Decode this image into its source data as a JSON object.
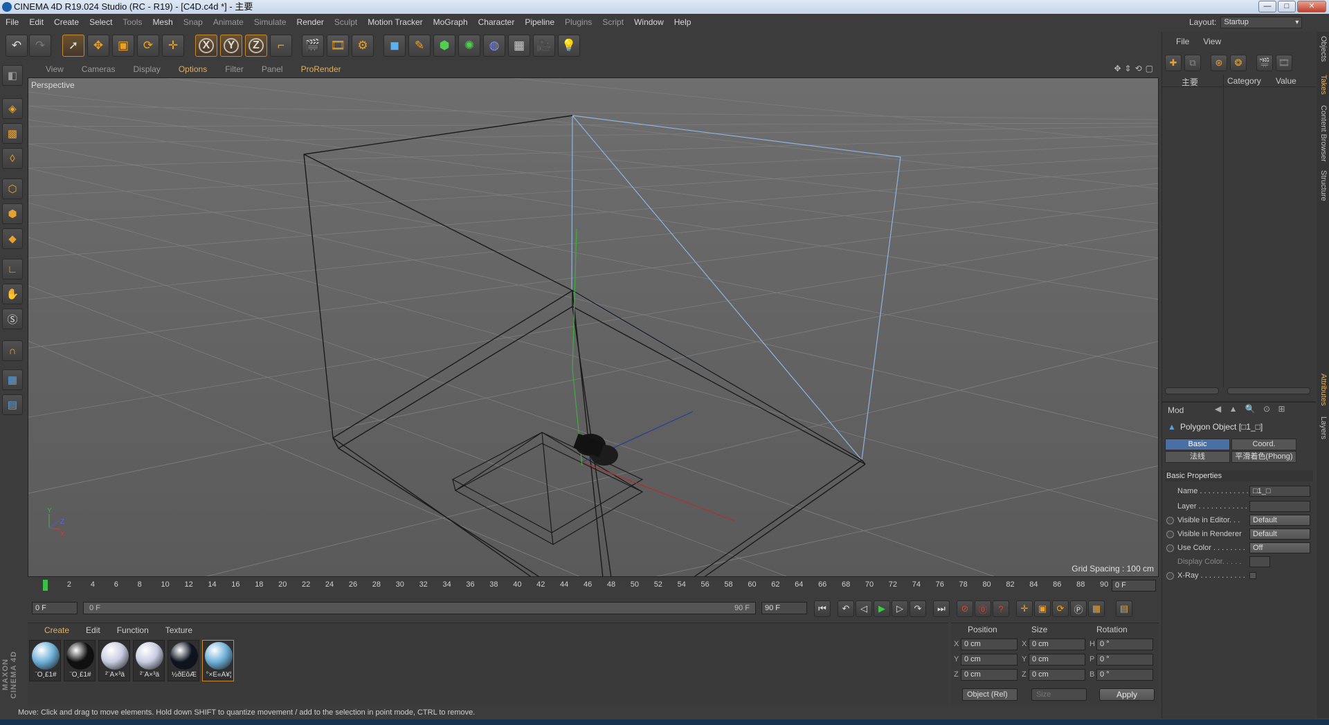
{
  "window": {
    "title": "CINEMA 4D R19.024 Studio (RC - R19) - [C4D.c4d *] - 主要",
    "minimize": "—",
    "maximize": "□",
    "close": "✕"
  },
  "menubar": {
    "items": [
      {
        "label": "File"
      },
      {
        "label": "Edit"
      },
      {
        "label": "Create"
      },
      {
        "label": "Select"
      },
      {
        "label": "Tools"
      },
      {
        "label": "Mesh"
      },
      {
        "label": "Snap"
      },
      {
        "label": "Animate"
      },
      {
        "label": "Simulate"
      },
      {
        "label": "Render"
      },
      {
        "label": "Sculpt"
      },
      {
        "label": "Motion Tracker"
      },
      {
        "label": "MoGraph"
      },
      {
        "label": "Character"
      },
      {
        "label": "Pipeline"
      },
      {
        "label": "Plugins"
      },
      {
        "label": "Script"
      },
      {
        "label": "Window"
      },
      {
        "label": "Help"
      }
    ],
    "layout_label": "Layout:",
    "layout_value": "Startup"
  },
  "toolbar": {
    "axis_x": "X",
    "axis_y": "Y",
    "axis_z": "Z"
  },
  "viewport": {
    "menu": [
      {
        "label": "View"
      },
      {
        "label": "Cameras"
      },
      {
        "label": "Display"
      },
      {
        "label": "Options"
      },
      {
        "label": "Filter"
      },
      {
        "label": "Panel"
      },
      {
        "label": "ProRender"
      }
    ],
    "camera_label": "Perspective",
    "grid_spacing": "Grid Spacing : 100 cm",
    "axis_y": "Y",
    "axis_z": "Z",
    "axis_x": "X"
  },
  "timeline": {
    "ticks": [
      "0",
      "2",
      "4",
      "6",
      "8",
      "10",
      "12",
      "14",
      "16",
      "18",
      "20",
      "22",
      "24",
      "26",
      "28",
      "30",
      "32",
      "34",
      "36",
      "38",
      "40",
      "42",
      "44",
      "46",
      "48",
      "50",
      "52",
      "54",
      "56",
      "58",
      "60",
      "62",
      "64",
      "66",
      "68",
      "70",
      "72",
      "74",
      "76",
      "78",
      "80",
      "82",
      "84",
      "86",
      "88",
      "90"
    ],
    "current_frame_field": "0 F",
    "start_field": "0 F",
    "slider_start": "0 F",
    "slider_end": "90 F",
    "end_field": "90 F"
  },
  "materials": {
    "menu": [
      {
        "label": "Create"
      },
      {
        "label": "Edit"
      },
      {
        "label": "Function"
      },
      {
        "label": "Texture"
      }
    ],
    "items": [
      {
        "name": "¨O¸£1#",
        "color": "#6fb0d8"
      },
      {
        "name": "¨O¸£1#",
        "color": "#101010"
      },
      {
        "name": "²¨Â×³ä",
        "color": "#c8cce0"
      },
      {
        "name": "²¨Â×³ä",
        "color": "#c8cce0"
      },
      {
        "name": "½ðÊôÆ",
        "color": "#0e1420"
      },
      {
        "name": "°×É«Â¥¦",
        "color": "#6fb0d8"
      }
    ]
  },
  "coords": {
    "head_position": "Position",
    "head_size": "Size",
    "head_rotation": "Rotation",
    "rows": [
      {
        "a1": "X",
        "v1": "0 cm",
        "a2": "X",
        "v2": "0 cm",
        "a3": "H",
        "v3": "0 °"
      },
      {
        "a1": "Y",
        "v1": "0 cm",
        "a2": "Y",
        "v2": "0 cm",
        "a3": "P",
        "v3": "0 °"
      },
      {
        "a1": "Z",
        "v1": "0 cm",
        "a2": "Z",
        "v2": "0 cm",
        "a3": "B",
        "v3": "0 °"
      }
    ],
    "mode": "Object (Rel)",
    "size_mode": "Size",
    "apply": "Apply"
  },
  "status": "Move: Click and drag to move elements. Hold down SHIFT to quantize movement / add to the selection in point mode, CTRL to remove.",
  "objects": {
    "menu": [
      {
        "label": "File"
      },
      {
        "label": "View"
      }
    ],
    "col_name": "主要",
    "col_category": "Category",
    "col_value": "Value"
  },
  "attributes": {
    "menu": "Mod",
    "title": "Polygon Object [□1_□]",
    "tabs": {
      "basic": "Basic",
      "coord": "Coord.",
      "normal": "法线",
      "phong": "平滑着色(Phong)"
    },
    "section": "Basic Properties",
    "rows": [
      {
        "label": "Name . . . . . . . . . . . .",
        "value": "□1_□"
      },
      {
        "label": "Layer . . . . . . . . . . . .",
        "value": ""
      },
      {
        "label": "Visible in Editor. . .",
        "value": "Default"
      },
      {
        "label": "Visible in Renderer",
        "value": "Default"
      },
      {
        "label": "Use Color . . . . . . . .",
        "value": "Off"
      },
      {
        "label": "Display Color. . . . .",
        "value": ""
      },
      {
        "label": "X-Ray . . . . . . . . . . .",
        "value": ""
      }
    ]
  },
  "side_tabs": [
    {
      "label": "Objects"
    },
    {
      "label": "Takes"
    },
    {
      "label": "Content Browser"
    },
    {
      "label": "Structure"
    },
    {
      "label": "Attributes"
    },
    {
      "label": "Layers"
    }
  ],
  "logo": "MAXON CINEMA 4D"
}
